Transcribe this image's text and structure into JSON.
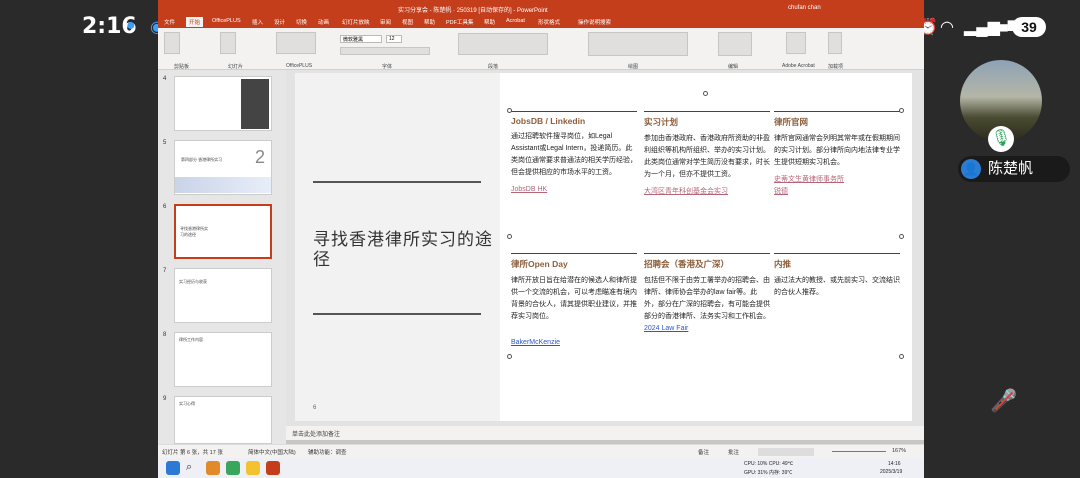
{
  "phone": {
    "time": "2:16",
    "battery": "39",
    "icons": [
      "app-icon",
      "app-icon-2",
      "nfc-icon",
      "bluetooth-icon",
      "mute-icon",
      "alarm-icon",
      "wifi-icon",
      "signal-icon",
      "signal-icon-2",
      "battery-icon"
    ]
  },
  "ppt": {
    "title": "实习分享会 - 陈楚帆 · 250319 [自动保存的] - PowerPoint",
    "user": "chufan chan",
    "tabs": [
      "文件",
      "开始",
      "OfficePLUS",
      "插入",
      "设计",
      "切换",
      "动画",
      "幻灯片放映",
      "审阅",
      "视图",
      "帮助",
      "PDF工具集",
      "帮助",
      "Acrobat",
      "形状格式",
      "操作说明搜索"
    ],
    "active_tab": "开始",
    "ribbon_groups": [
      "剪贴板",
      "幻灯片",
      "OfficePLUS",
      "字体",
      "段落",
      "绘图",
      "编辑",
      "Adobe Acrobat",
      "加载项"
    ],
    "font_name": "微软雅黑",
    "font_size": "12",
    "buttons": {
      "paste": "粘贴",
      "new_slide": "新建幻灯片",
      "layout": "版式",
      "reset": "重置",
      "section": "节",
      "office_tpl": "模板图片",
      "theme": "主题图库",
      "text_direction": "文字方向",
      "align_text": "对齐文本",
      "smartart": "转换为SmartArt",
      "arrange": "排列",
      "quick_styles": "快速样式",
      "shape_fill": "形状填充",
      "shape_outline": "形状轮廓",
      "shape_effects": "形状效果",
      "find": "查找",
      "replace": "替换",
      "select": "选择",
      "create_pdf": "创建并共享Adobe PDF",
      "addins": "加载项"
    }
  },
  "thumbnails": [
    {
      "num": "4",
      "label": ""
    },
    {
      "num": "5",
      "label": "第四部分 香港律所实习",
      "big": "2"
    },
    {
      "num": "6",
      "label": "寻找香港律所实习的途径"
    },
    {
      "num": "7",
      "label": "实习经历与收获"
    },
    {
      "num": "8",
      "label": "律所工作内容"
    },
    {
      "num": "9",
      "label": "实习心得"
    }
  ],
  "slide": {
    "title": "寻找香港律所实习的途径",
    "number": "6",
    "columns": [
      {
        "heading": "JobsDB / Linkedin",
        "text": "通过招聘软件搜寻岗位，如Legal Assistant或Legal Intern，投递简历。此类岗位通常要求普通法的相关学历经验，但会提供相应的市场水平的工资。",
        "links": [
          "JobsDB HK"
        ]
      },
      {
        "heading": "实习计划",
        "text": "参加由香港政府、香港政府所资助的非盈利组织等机构所组织、举办的实习计划。此类岗位通常对学生简历没有要求，时长为一个月，但亦不提供工资。",
        "links": [
          "大湾区青年科创基金会实习"
        ]
      },
      {
        "heading": "律所官网",
        "text": "律所官网通常会列明其常年或在假期期间的实习计划。部分律所向内地法律专业学生提供短期实习机会。",
        "links": [
          "史蒂文生黄律师事务所",
          "锐德"
        ]
      },
      {
        "heading": "律所Open Day",
        "text": "律所开放日旨在给潜在的候选人和律所提供一个交流的机会，可以考虑瞄准有境内背景的合伙人，请其提供职业建议，并推荐实习岗位。",
        "links": [
          "BakerMcKenzie"
        ]
      },
      {
        "heading": "招聘会（香港及广深）",
        "text": "包括但不限于由劳工署举办的招聘会、由律所、律师协会举办的law fair等。此外，部分在广深的招聘会，有可能会提供部分的香港律所、法务实习和工作机会。",
        "links": [
          "2024 Law Fair"
        ]
      },
      {
        "heading": "内推",
        "text": "通过法大的教授、或先前实习、交流结识的合伙人推荐。",
        "links": []
      }
    ]
  },
  "notes_placeholder": "单击此处添加备注",
  "status": {
    "slide_info": "幻灯片 第 6 张，共 17 张",
    "language": "简体中文(中国大陆)",
    "accessibility": "辅助功能：调查",
    "notes_btn": "备注",
    "comments_btn": "批注",
    "zoom": "167%"
  },
  "taskbar": {
    "cpu": "CPU: 10% CPU: 49℃",
    "gpu": "GPU: 31% 内存: 39℃",
    "time": "14:16",
    "date": "2025/3/19"
  },
  "meeting": {
    "participant": "陈楚帆",
    "avatar_letter": "👤"
  },
  "colors": {
    "ppt_accent": "#c43e1c",
    "heading": "#8c5e3c",
    "link": "#b56576",
    "blue_link": "#2a58c9"
  }
}
